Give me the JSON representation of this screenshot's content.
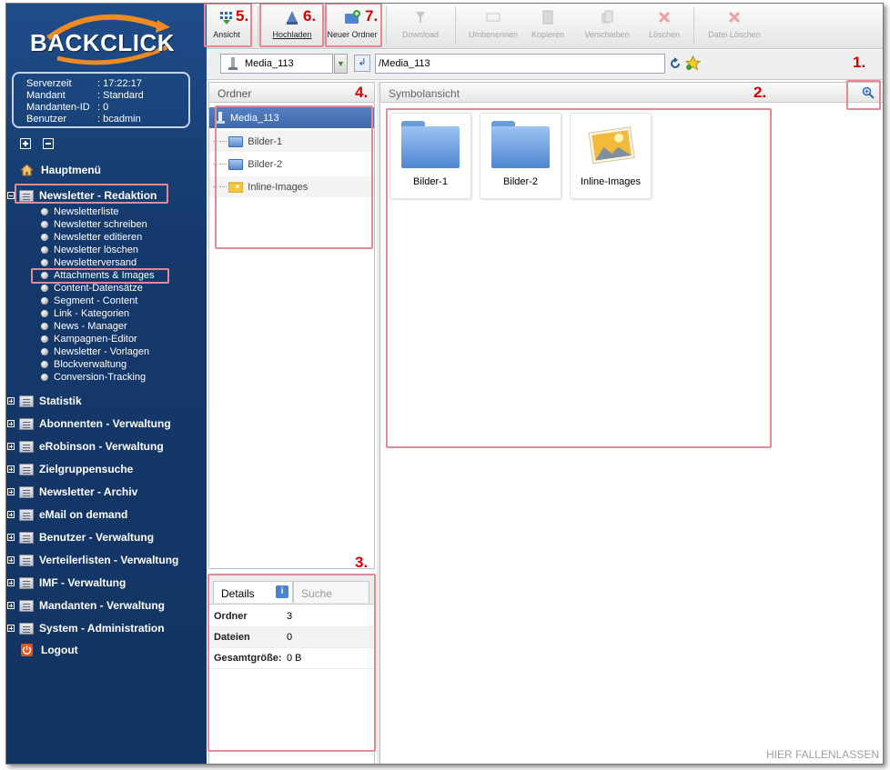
{
  "sidebar": {
    "logo": "BACKCLICK",
    "info": [
      {
        "key": "Serverzeit",
        "value": ": 17:22:17"
      },
      {
        "key": "Mandant",
        "value": ": Standard"
      },
      {
        "key": "Mandanten-ID",
        "value": ": 0"
      },
      {
        "key": "Benutzer",
        "value": ": bcadmin"
      }
    ],
    "main_menu": "Hauptmenü",
    "newsletter_section": "Newsletter - Redaktion",
    "sub_items": [
      "Newsletterliste",
      "Newsletter schreiben",
      "Newsletter editieren",
      "Newsletter löschen",
      "Newsletterversand",
      "Attachments & Images",
      "Content-Datensätze",
      "Segment - Content",
      "Link - Kategorien",
      "News - Manager",
      "Kampagnen-Editor",
      "Newsletter - Vorlagen",
      "Blockverwaltung",
      "Conversion-Tracking"
    ],
    "sections": [
      "Statistik",
      "Abonnenten - Verwaltung",
      "eRobinson - Verwaltung",
      "Zielgruppensuche",
      "Newsletter - Archiv",
      "eMail on demand",
      "Benutzer - Verwaltung",
      "Verteilerlisten - Verwaltung",
      "IMF - Verwaltung",
      "Mandanten - Verwaltung",
      "System - Administration"
    ],
    "logout": "Logout"
  },
  "toolbar": {
    "ansicht": "Ansicht",
    "hochladen": "Hochladen",
    "neuer_ordner": "Neuer Ordner",
    "download": "Download",
    "umbenennen": "Umbenennen",
    "kopieren": "Kopieren",
    "verschieben": "Verschieben",
    "loeschen": "Löschen",
    "datei_loeschen": "Datei Löschen"
  },
  "annotations": {
    "n1": "1.",
    "n2": "2.",
    "n3": "3.",
    "n4": "4.",
    "n5": "5.",
    "n6": "6.",
    "n7": "7."
  },
  "pathbar": {
    "folder": "Media_113",
    "path": "/Media_113"
  },
  "folders_pane": {
    "title": "Ordner",
    "root": "Media_113",
    "children": [
      "Bilder-1",
      "Bilder-2",
      "Inline-Images"
    ]
  },
  "icon_view": {
    "title": "Symbolansicht",
    "items": [
      "Bilder-1",
      "Bilder-2",
      "Inline-Images"
    ],
    "drop_hint": "HIER FALLENLASSEN"
  },
  "details": {
    "tab_details": "Details",
    "tab_search": "Suche",
    "rows": [
      {
        "label": "Ordner",
        "value": "3"
      },
      {
        "label": "Dateien",
        "value": "0"
      },
      {
        "label": "Gesamtgröße:",
        "value": "0 B"
      }
    ]
  }
}
